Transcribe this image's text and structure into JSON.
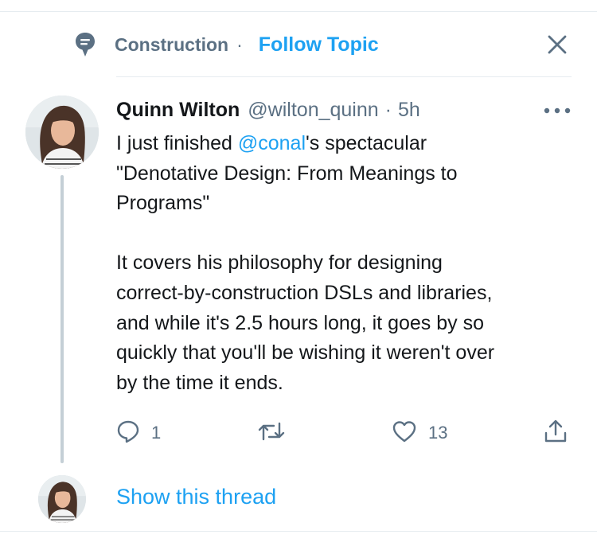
{
  "topic": {
    "name": "Construction",
    "separator": "·",
    "follow_label": "Follow Topic",
    "icon": "topic-speech-bubble-icon"
  },
  "tweet": {
    "author_name": "Quinn Wilton",
    "handle": "@wilton_quinn",
    "separator": "·",
    "time": "5h",
    "text": {
      "l1_pre": "I just finished ",
      "l1_mention": "@conal",
      "l1_post": "'s spectacular",
      "l2": "\"Denotative Design: From Meanings to",
      "l3": "Programs\"",
      "l4": "It covers his philosophy for designing",
      "l5": "correct-by-construction DSLs and libraries,",
      "l6": "and while it's 2.5 hours long, it goes by so",
      "l7": "quickly that you'll be wishing it weren't over",
      "l8": "by the time it ends."
    },
    "actions": {
      "replies": "1",
      "retweets": "",
      "likes": "13"
    }
  },
  "show_thread_label": "Show this thread",
  "colors": {
    "accent": "#1da1f2",
    "secondary_text": "#5b7083",
    "primary_text": "#14171a",
    "thread_line": "#c4cfd6",
    "divider": "#e6ecf0"
  }
}
